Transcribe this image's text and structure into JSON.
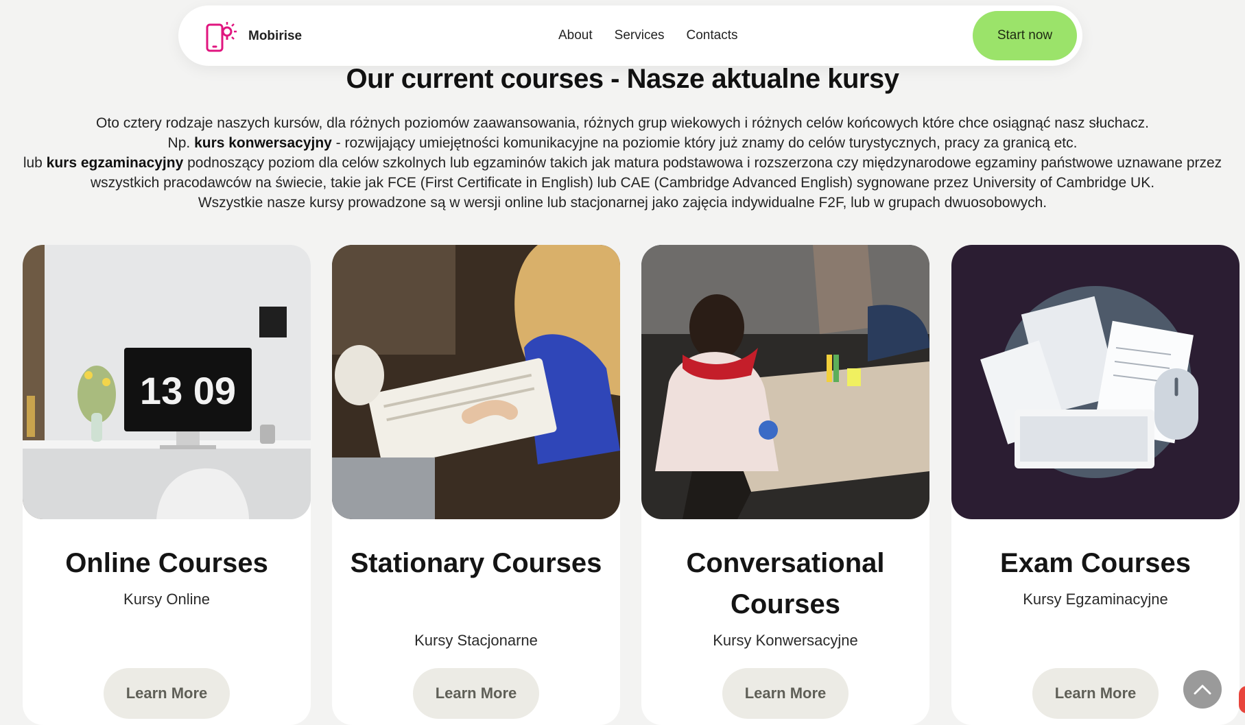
{
  "brand": {
    "name": "Mobirise",
    "logo_icon": "phone-idea-icon",
    "logo_color": "#e0157f"
  },
  "nav": {
    "links": [
      "About",
      "Services",
      "Contacts"
    ],
    "cta": "Start now",
    "cta_color": "#9be36a"
  },
  "section": {
    "title": "Our current courses - Nasze aktualne kursy",
    "line1": "Oto cztery rodzaje naszych kursów, dla różnych poziomów zaawansowania, różnych grup wiekowych i różnych celów końcowych które chce osiągnąć nasz słuchacz.",
    "line2_prefix": "Np. ",
    "line2_bold": "kurs konwersacyjny",
    "line2_rest": " - rozwijający umiejętności komunikacyjne na poziomie który już znamy do celów turystycznych, pracy za granicą etc.",
    "line3_prefix": "lub ",
    "line3_bold": "kurs egzaminacyjny",
    "line3_rest": " podnoszący poziom dla celów szkolnych lub egzaminów takich jak matura podstawowa i rozszerzona czy międzynarodowe egzaminy państwowe uznawane przez wszystkich pracodawców na świecie, takie jak FCE (First Certificate in English) lub CAE (Cambridge Advanced English) sygnowane przez University of Cambridge UK.",
    "line4": "Wszystkie nasze kursy prowadzone są w wersji online lub stacjonarnej jako zajęcia indywidualne F2F, lub w grupach dwuosobowych."
  },
  "cards": [
    {
      "title": "Online Courses",
      "subtitle": "Kursy Online",
      "button": "Learn More",
      "clock": "13 09"
    },
    {
      "title": "Stationary Courses",
      "subtitle": "Kursy Stacjonarne",
      "button": "Learn More"
    },
    {
      "title": "Conversational Courses",
      "subtitle": "Kursy Konwersacyjne",
      "button": "Learn More"
    },
    {
      "title": "Exam Courses",
      "subtitle": "Kursy Egzaminacyjne",
      "button": "Learn More"
    }
  ],
  "scroll_top_icon": "chevron-up-icon"
}
